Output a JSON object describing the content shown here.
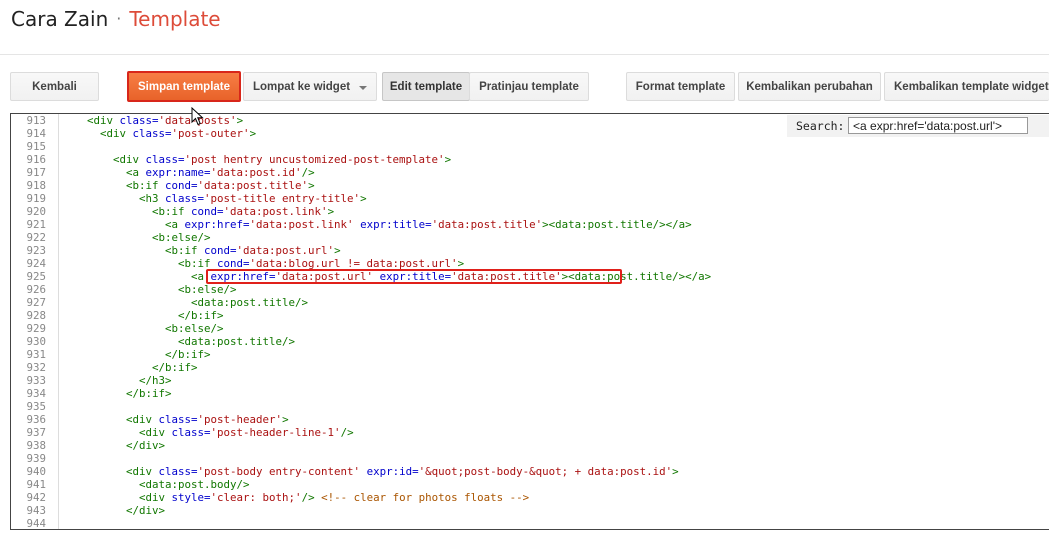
{
  "header": {
    "blog_name": "Cara Zain",
    "separator": "·",
    "page_title": "Template"
  },
  "toolbar": {
    "back_label": "Kembali",
    "save_label": "Simpan template",
    "jump_label": "Lompat ke widget",
    "edit_label": "Edit template",
    "preview_label": "Pratinjau template",
    "format_label": "Format template",
    "revert_label": "Kembalikan perubahan",
    "revert_widget_label": "Kembalikan template widget k"
  },
  "search": {
    "label": "Search:",
    "value": "<a expr:href='data:post.url'>"
  },
  "editor": {
    "line_numbers": [
      "913",
      "914",
      "915",
      "916",
      "917",
      "918",
      "919",
      "920",
      "921",
      "922",
      "923",
      "924",
      "925",
      "926",
      "927",
      "928",
      "929",
      "930",
      "931",
      "932",
      "933",
      "934",
      "935",
      "936",
      "937",
      "938",
      "939",
      "940",
      "941",
      "942",
      "943",
      "944"
    ],
    "highlighted_line": "925",
    "lines": [
      [
        [
          "    ",
          "t"
        ],
        [
          "<div ",
          "tag"
        ],
        [
          "class=",
          "attr"
        ],
        [
          "'data-posts'",
          "val"
        ],
        [
          ">",
          "tag"
        ]
      ],
      [
        [
          "      ",
          "t"
        ],
        [
          "<div ",
          "tag"
        ],
        [
          "class=",
          "attr"
        ],
        [
          "'post-outer'",
          "val"
        ],
        [
          ">",
          "tag"
        ]
      ],
      [],
      [
        [
          "        ",
          "t"
        ],
        [
          "<div ",
          "tag"
        ],
        [
          "class=",
          "attr"
        ],
        [
          "'post hentry uncustomized-post-template'",
          "val"
        ],
        [
          ">",
          "tag"
        ]
      ],
      [
        [
          "          ",
          "t"
        ],
        [
          "<a ",
          "tag"
        ],
        [
          "expr:name=",
          "attr"
        ],
        [
          "'data:post.id'",
          "val"
        ],
        [
          "/>",
          "tag"
        ]
      ],
      [
        [
          "          ",
          "t"
        ],
        [
          "<b:if ",
          "tag"
        ],
        [
          "cond=",
          "attr"
        ],
        [
          "'data:post.title'",
          "val"
        ],
        [
          ">",
          "tag"
        ]
      ],
      [
        [
          "            ",
          "t"
        ],
        [
          "<h3 ",
          "tag"
        ],
        [
          "class=",
          "attr"
        ],
        [
          "'post-title entry-title'",
          "val"
        ],
        [
          ">",
          "tag"
        ]
      ],
      [
        [
          "              ",
          "t"
        ],
        [
          "<b:if ",
          "tag"
        ],
        [
          "cond=",
          "attr"
        ],
        [
          "'data:post.link'",
          "val"
        ],
        [
          ">",
          "tag"
        ]
      ],
      [
        [
          "                ",
          "t"
        ],
        [
          "<a ",
          "tag"
        ],
        [
          "expr:href=",
          "attr"
        ],
        [
          "'data:post.link'",
          "val"
        ],
        [
          " ",
          "t"
        ],
        [
          "expr:title=",
          "attr"
        ],
        [
          "'data:post.title'",
          "val"
        ],
        [
          "><data:post.title/></a>",
          "tag"
        ]
      ],
      [
        [
          "              ",
          "t"
        ],
        [
          "<b:else/>",
          "tag"
        ]
      ],
      [
        [
          "                ",
          "t"
        ],
        [
          "<b:if ",
          "tag"
        ],
        [
          "cond=",
          "attr"
        ],
        [
          "'data:post.url'",
          "val"
        ],
        [
          ">",
          "tag"
        ]
      ],
      [
        [
          "                  ",
          "t"
        ],
        [
          "<b:if ",
          "tag"
        ],
        [
          "cond=",
          "attr"
        ],
        [
          "'data:blog.url != data:post.url'",
          "val"
        ],
        [
          ">",
          "tag"
        ]
      ],
      [
        [
          "                    ",
          "t"
        ],
        [
          "<a ",
          "tag"
        ],
        [
          "expr:href=",
          "attr"
        ],
        [
          "'data:post.url'",
          "val"
        ],
        [
          " ",
          "t"
        ],
        [
          "expr:title=",
          "attr"
        ],
        [
          "'data:post.title'",
          "val"
        ],
        [
          "><data:post.title/></a>",
          "tag"
        ]
      ],
      [
        [
          "                  ",
          "t"
        ],
        [
          "<b:else/>",
          "tag"
        ]
      ],
      [
        [
          "                    ",
          "t"
        ],
        [
          "<data:post.title/>",
          "tag"
        ]
      ],
      [
        [
          "                  ",
          "t"
        ],
        [
          "</b:if>",
          "tag"
        ]
      ],
      [
        [
          "                ",
          "t"
        ],
        [
          "<b:else/>",
          "tag"
        ]
      ],
      [
        [
          "                  ",
          "t"
        ],
        [
          "<data:post.title/>",
          "tag"
        ]
      ],
      [
        [
          "                ",
          "t"
        ],
        [
          "</b:if>",
          "tag"
        ]
      ],
      [
        [
          "              ",
          "t"
        ],
        [
          "</b:if>",
          "tag"
        ]
      ],
      [
        [
          "            ",
          "t"
        ],
        [
          "</h3>",
          "tag"
        ]
      ],
      [
        [
          "          ",
          "t"
        ],
        [
          "</b:if>",
          "tag"
        ]
      ],
      [],
      [
        [
          "          ",
          "t"
        ],
        [
          "<div ",
          "tag"
        ],
        [
          "class=",
          "attr"
        ],
        [
          "'post-header'",
          "val"
        ],
        [
          ">",
          "tag"
        ]
      ],
      [
        [
          "            ",
          "t"
        ],
        [
          "<div ",
          "tag"
        ],
        [
          "class=",
          "attr"
        ],
        [
          "'post-header-line-1'",
          "val"
        ],
        [
          "/>",
          "tag"
        ]
      ],
      [
        [
          "          ",
          "t"
        ],
        [
          "</div>",
          "tag"
        ]
      ],
      [],
      [
        [
          "          ",
          "t"
        ],
        [
          "<div ",
          "tag"
        ],
        [
          "class=",
          "attr"
        ],
        [
          "'post-body entry-content'",
          "val"
        ],
        [
          " ",
          "t"
        ],
        [
          "expr:id=",
          "attr"
        ],
        [
          "'&quot;post-body-&quot; + data:post.id'",
          "val"
        ],
        [
          ">",
          "tag"
        ]
      ],
      [
        [
          "            ",
          "t"
        ],
        [
          "<data:post.body/>",
          "tag"
        ]
      ],
      [
        [
          "            ",
          "t"
        ],
        [
          "<div ",
          "tag"
        ],
        [
          "style=",
          "attr"
        ],
        [
          "'clear: both;'",
          "val"
        ],
        [
          "/> ",
          "tag"
        ],
        [
          "<!-- clear for photos floats -->",
          "cmt"
        ]
      ],
      [
        [
          "          ",
          "t"
        ],
        [
          "</div>",
          "tag"
        ]
      ],
      []
    ]
  },
  "colors": {
    "accent": "#dd4b39",
    "save_button": "#f0682d",
    "highlight_border": "#e0201a",
    "tag": "#117700",
    "attribute": "#0000cc",
    "string": "#aa1111"
  }
}
